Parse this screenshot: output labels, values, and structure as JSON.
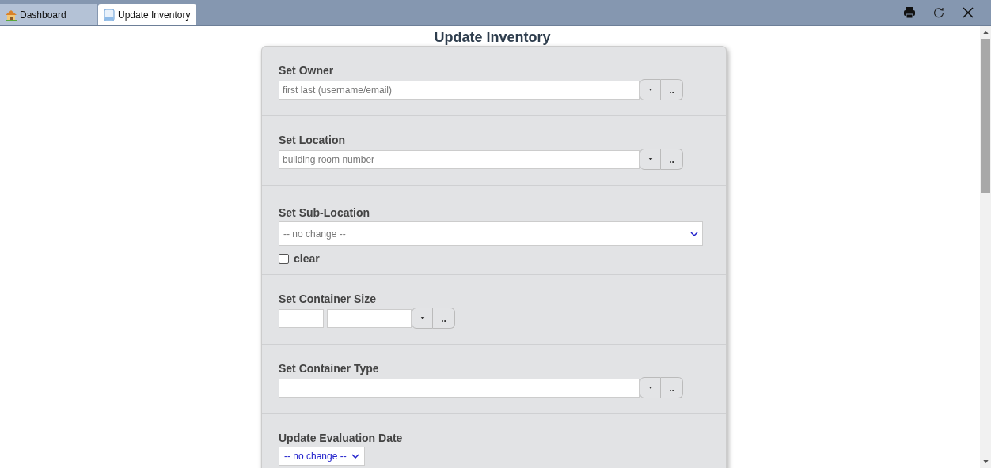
{
  "tabs": [
    {
      "label": "Dashboard",
      "selected": false
    },
    {
      "label": "Update Inventory",
      "selected": true
    }
  ],
  "title": "Update Inventory",
  "sections": [
    {
      "kind": "lookup",
      "label": "Set Owner",
      "placeholder": "first last (username/email)",
      "more_button": ".."
    },
    {
      "kind": "lookup",
      "label": "Set Location",
      "placeholder": "building room number",
      "more_button": ".."
    },
    {
      "kind": "select",
      "label": "Set Sub-Location",
      "value": "-- no change --",
      "checkbox": {
        "label": "clear",
        "checked": false
      }
    },
    {
      "kind": "size",
      "label": "Set Container Size",
      "more_button": ".."
    },
    {
      "kind": "lookup",
      "label": "Set Container Type",
      "more_button": ".."
    },
    {
      "kind": "date",
      "label": "Update Evaluation Date",
      "value": "-- no change --"
    }
  ]
}
